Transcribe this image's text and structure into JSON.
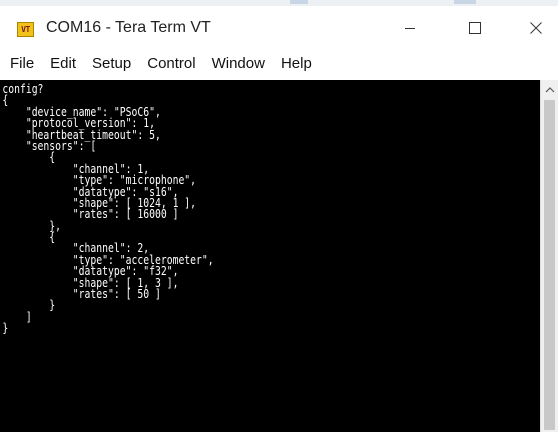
{
  "window": {
    "app_icon_text": "VT",
    "title": "COM16 - Tera Term VT",
    "controls": {
      "minimize": "minimize-icon",
      "maximize": "maximize-icon",
      "close": "close-icon"
    }
  },
  "menu": {
    "items": [
      "File",
      "Edit",
      "Setup",
      "Control",
      "Window",
      "Help"
    ]
  },
  "terminal": {
    "background": "#000000",
    "foreground": "#ffffff",
    "lines": [
      "config?",
      "{",
      "    \"device_name\": \"PSoC6\",",
      "    \"protocol_version\": 1,",
      "    \"heartbeat_timeout\": 5,",
      "    \"sensors\": [",
      "        {",
      "            \"channel\": 1,",
      "            \"type\": \"microphone\",",
      "            \"datatype\": \"s16\",",
      "            \"shape\": [ 1024, 1 ],",
      "            \"rates\": [ 16000 ]",
      "        },",
      "        {",
      "            \"channel\": 2,",
      "            \"type\": \"accelerometer\",",
      "            \"datatype\": \"f32\",",
      "            \"shape\": [ 1, 3 ],",
      "            \"rates\": [ 50 ]",
      "        }",
      "    ]",
      "}"
    ]
  },
  "scrollbar": {
    "up_arrow": "chevron-up-icon"
  }
}
